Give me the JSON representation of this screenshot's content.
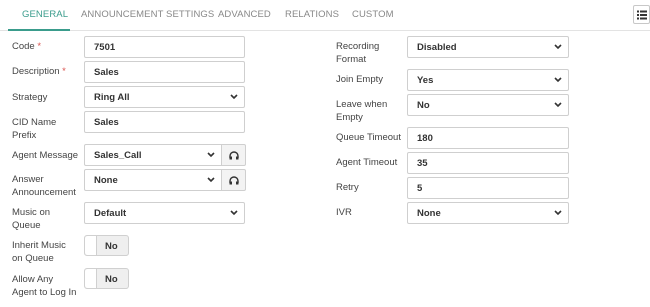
{
  "tabs": [
    "GENERAL",
    "ANNOUNCEMENT SETTINGS",
    "ADVANCED",
    "RELATIONS",
    "CUSTOM"
  ],
  "left": {
    "code_label": "Code",
    "code_value": "7501",
    "description_label": "Description",
    "description_value": "Sales",
    "strategy_label": "Strategy",
    "strategy_value": "Ring All",
    "cid_label": "CID Name\nPrefix",
    "cid_value": "Sales",
    "agent_message_label": "Agent Message",
    "agent_message_value": "Sales_Call",
    "answer_announcement_label": "Answer\nAnnouncement",
    "answer_announcement_value": "None",
    "music_label": "Music on\nQueue",
    "music_value": "Default",
    "inherit_label": "Inherit Music\non Queue",
    "inherit_value": "No",
    "allow_label": "Allow Any\nAgent to Log In",
    "allow_value": "No",
    "required_mark": "*"
  },
  "right": {
    "recording_label": "Recording\nFormat",
    "recording_value": "Disabled",
    "join_empty_label": "Join Empty",
    "join_empty_value": "Yes",
    "leave_empty_label": "Leave when\nEmpty",
    "leave_empty_value": "No",
    "queue_timeout_label": "Queue Timeout",
    "queue_timeout_value": "180",
    "agent_timeout_label": "Agent Timeout",
    "agent_timeout_value": "35",
    "retry_label": "Retry",
    "retry_value": "5",
    "ivr_label": "IVR",
    "ivr_value": "None"
  },
  "colors": {
    "accent": "#3a9c8c",
    "required": "#d9534f"
  },
  "icons": {
    "menu": "list-menu-icon",
    "play": "headphones-icon",
    "caret": "chevron-down-icon"
  }
}
